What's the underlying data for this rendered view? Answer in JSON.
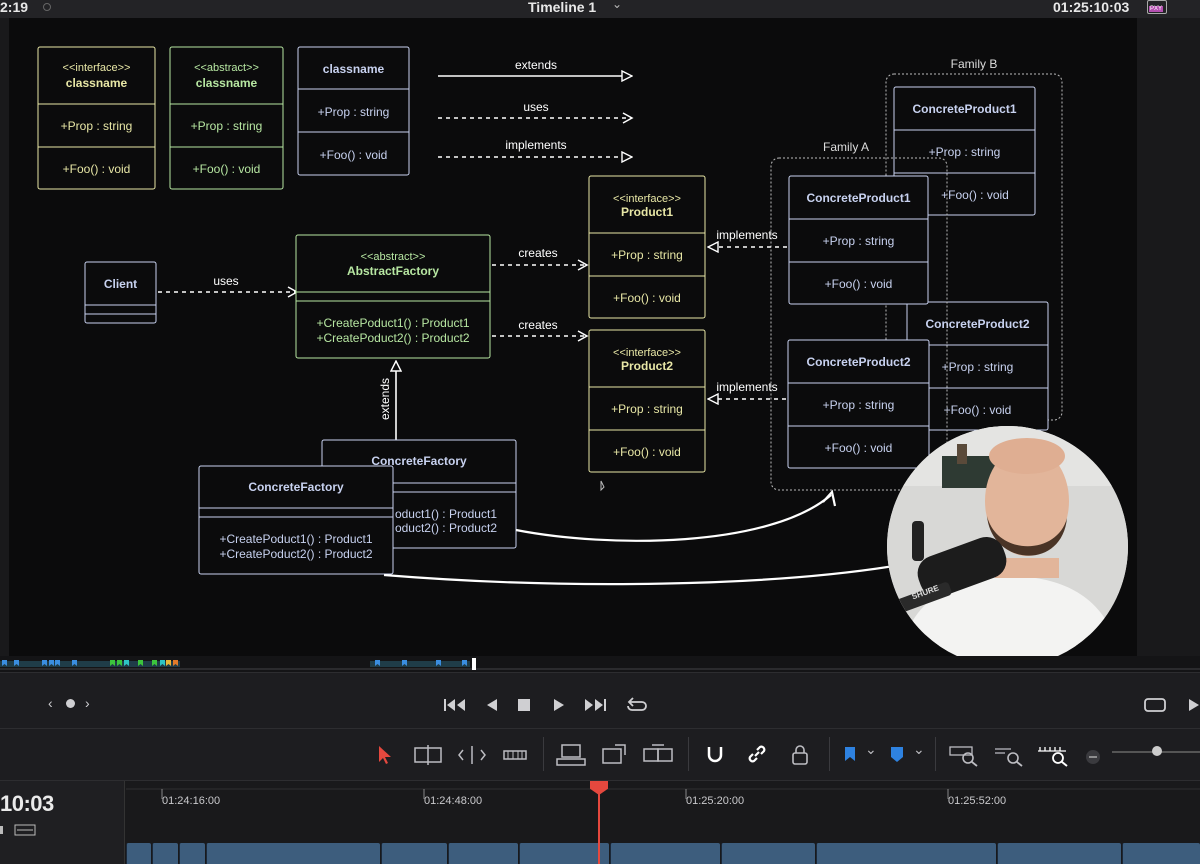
{
  "top_bar": {
    "timecode_left": "2:19",
    "timeline_title": "Timeline 1",
    "timecode_right": "01:25:10:03",
    "proxy_badge": "PXY"
  },
  "diagram": {
    "legend": {
      "interface_box": {
        "stereotype": "<<interface>>",
        "name": "classname",
        "prop": "+Prop : string",
        "method": "+Foo() : void"
      },
      "abstract_box": {
        "stereotype": "<<abstract>>",
        "name": "classname",
        "prop": "+Prop : string",
        "method": "+Foo() : void"
      },
      "class_box": {
        "name": "classname",
        "prop": "+Prop : string",
        "method": "+Foo() : void"
      },
      "extends": "extends",
      "uses": "uses",
      "implements": "implements"
    },
    "client": {
      "name": "Client"
    },
    "abstract_factory": {
      "stereotype": "<<abstract>>",
      "name": "AbstractFactory",
      "method1": "+CreatePoduct1() : Product1",
      "method2": "+CreatePoduct2() : Product2"
    },
    "product1": {
      "stereotype": "<<interface>>",
      "name": "Product1",
      "prop": "+Prop : string",
      "method": "+Foo() : void"
    },
    "product2": {
      "stereotype": "<<interface>>",
      "name": "Product2",
      "prop": "+Prop : string",
      "method": "+Foo() : void"
    },
    "concrete_factory_back": {
      "name": "ConcreteFactory",
      "method1": "oduct1() : Product1",
      "method2": "oduct2() : Product2"
    },
    "concrete_factory_front": {
      "name": "ConcreteFactory",
      "method1": "+CreatePoduct1() : Product1",
      "method2": "+CreatePoduct2() : Product2"
    },
    "family_a": {
      "label": "Family A",
      "cp1": {
        "name": "ConcreteProduct1",
        "prop": "+Prop : string",
        "method": "+Foo() : void"
      },
      "cp2": {
        "name": "ConcreteProduct2",
        "prop": "+Prop : string",
        "method": "+Foo() : void"
      }
    },
    "family_b": {
      "label": "Family B",
      "cp1": {
        "name": "ConcreteProduct1",
        "prop": "+Prop : string",
        "method": "+Foo() : void"
      },
      "cp2": {
        "name": "ConcreteProduct2",
        "prop": "+Prop : string",
        "method": "+Foo() : void"
      }
    },
    "labels": {
      "uses": "uses",
      "creates1": "creates",
      "creates2": "creates",
      "extends": "extends",
      "implements1": "implements",
      "implements2": "implements"
    }
  },
  "webcam": {
    "mic_brand": "SHURE"
  },
  "timeline": {
    "timecode": "10:03",
    "ruler": [
      "01:24:16:00",
      "01:24:48:00",
      "01:25:20:00",
      "01:25:52:00"
    ]
  },
  "colors": {
    "interface": "#e8e7a6",
    "abstract": "#b7e7a2",
    "class": "#c8d2f0",
    "playhead": "#e5483e",
    "clip": "#3d5d7d"
  }
}
